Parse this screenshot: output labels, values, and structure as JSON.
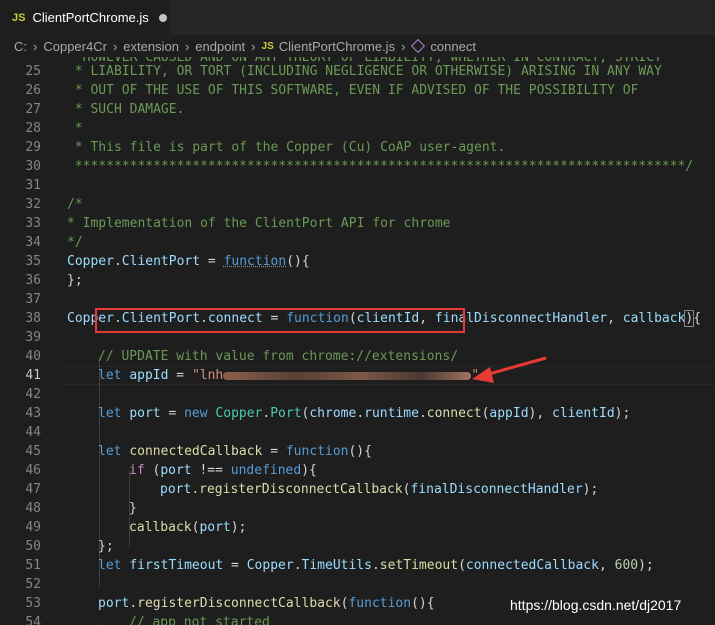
{
  "tab": {
    "badge": "JS",
    "title": "ClientPortChrome.js"
  },
  "breadcrumb": {
    "items": [
      "C:",
      "Copper4Cr",
      "extension",
      "endpoint"
    ],
    "file_badge": "JS",
    "file": "ClientPortChrome.js",
    "symbol": "connect"
  },
  "line_numbers": [
    "25",
    "26",
    "27",
    "28",
    "29",
    "30",
    "31",
    "32",
    "33",
    "34",
    "35",
    "36",
    "37",
    "38",
    "39",
    "40",
    "41",
    "42",
    "43",
    "44",
    "45",
    "46",
    "47",
    "48",
    "49",
    "50",
    "51",
    "52",
    "53",
    "54"
  ],
  "code": {
    "l25": " * LIABILITY, OR TORT (INCLUDING NEGLIGENCE OR OTHERWISE) ARISING IN ANY WAY",
    "l26": " * OUT OF THE USE OF THIS SOFTWARE, EVEN IF ADVISED OF THE POSSIBILITY OF",
    "l27": " * SUCH DAMAGE.",
    "l28": " *",
    "l29": " * This file is part of the Copper (Cu) CoAP user-agent.",
    "l30": " ******************************************************************************/",
    "l32": "/*",
    "l33": "* Implementation of the ClientPort API for chrome",
    "l34": "*/",
    "l35_obj": "Copper",
    "l35_prop": "ClientPort",
    "l35_kw": "function",
    "l35_tail": "(){",
    "l36": "};",
    "l38_obj": "Copper",
    "l38_prop1": "ClientPort",
    "l38_prop2": "connect",
    "l38_kw": "function",
    "l38_p1": "clientId",
    "l38_p2": "finalDisconnectHandler",
    "l38_p3": "callback",
    "l40": "// UPDATE with value from chrome://extensions/",
    "l41_kw": "let",
    "l41_var": "appId",
    "l41_str_start": "\"lnh",
    "l41_str_end": "\"",
    "l43_kw": "let",
    "l43_var": "port",
    "l43_new": "new",
    "l43_obj": "Copper",
    "l43_cls": "Port",
    "l43_a": "chrome",
    "l43_b": "runtime",
    "l43_fn": "connect",
    "l43_arg1": "appId",
    "l43_arg2": "clientId",
    "l45_kw": "let",
    "l45_var": "connectedCallback",
    "l45_fn": "function",
    "l46_if": "if",
    "l46_var": "port",
    "l46_undef": "undefined",
    "l47_obj": "port",
    "l47_fn": "registerDisconnectCallback",
    "l47_arg": "finalDisconnectHandler",
    "l48": "}",
    "l49_fn": "callback",
    "l49_arg": "port",
    "l50": "};",
    "l51_kw": "let",
    "l51_var": "firstTimeout",
    "l51_obj": "Copper",
    "l51_cls": "TimeUtils",
    "l51_fn": "setTimeout",
    "l51_arg": "connectedCallback",
    "l51_num": "600",
    "l53_obj": "port",
    "l53_fn": "registerDisconnectCallback",
    "l53_kw": "function",
    "l54": "// app not started"
  },
  "watermark": "https://blog.csdn.net/dj2017",
  "colors": {
    "comment": "#6a9955",
    "keyword": "#569cd6",
    "highlight_box": "#e63a34"
  },
  "icons": [
    "js-file-icon",
    "chevron-right-icon",
    "method-cube-icon",
    "modified-dot-icon",
    "red-arrow-annotation"
  ]
}
